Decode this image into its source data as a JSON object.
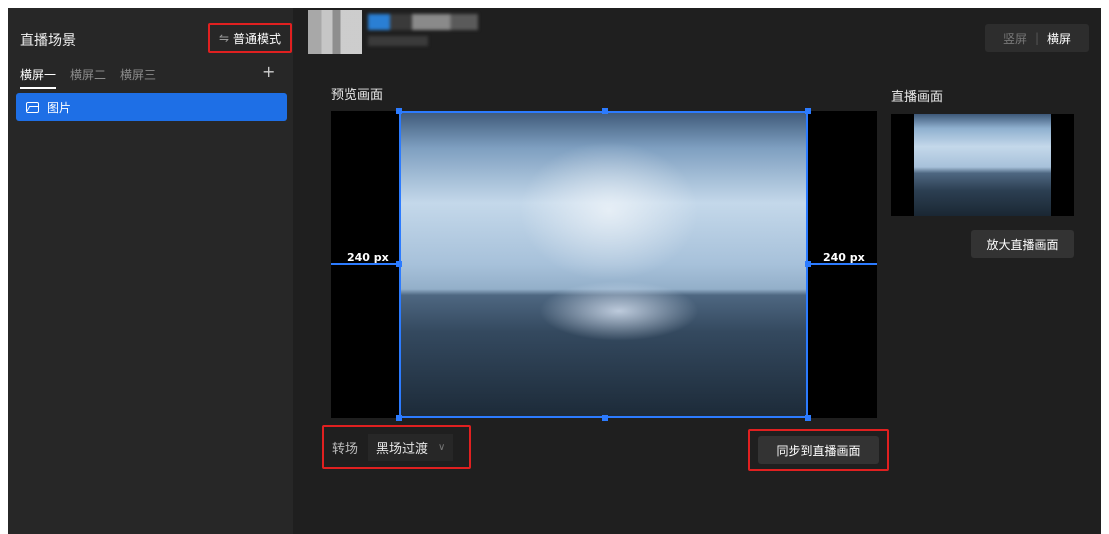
{
  "sidebar": {
    "title": "直播场景",
    "mode_button": {
      "icon": "swap-icon",
      "icon_glyph": "⇋",
      "label": "普通模式"
    },
    "tabs": [
      {
        "label": "横屏一",
        "active": true
      },
      {
        "label": "横屏二",
        "active": false
      },
      {
        "label": "横屏三",
        "active": false
      }
    ],
    "add_symbol": "+",
    "sources": [
      {
        "icon": "image-icon",
        "label": "图片",
        "selected": true
      }
    ]
  },
  "header": {
    "orientation": {
      "portrait": "竖屏",
      "separator": "|",
      "landscape": "横屏",
      "active": "landscape"
    }
  },
  "preview": {
    "title": "预览画面",
    "left_offset_label": "240 px",
    "right_offset_label": "240 px"
  },
  "live": {
    "title": "直播画面",
    "zoom_button": "放大直播画面"
  },
  "transition": {
    "label": "转场",
    "value": "黑场过渡",
    "caret_glyph": "∨"
  },
  "sync_button": "同步到直播画面",
  "colors": {
    "accent": "#1e6fe6",
    "selection": "#2c7bff",
    "highlight": "#e02020",
    "background": "#1f1f1f",
    "sidebar": "#272727"
  }
}
